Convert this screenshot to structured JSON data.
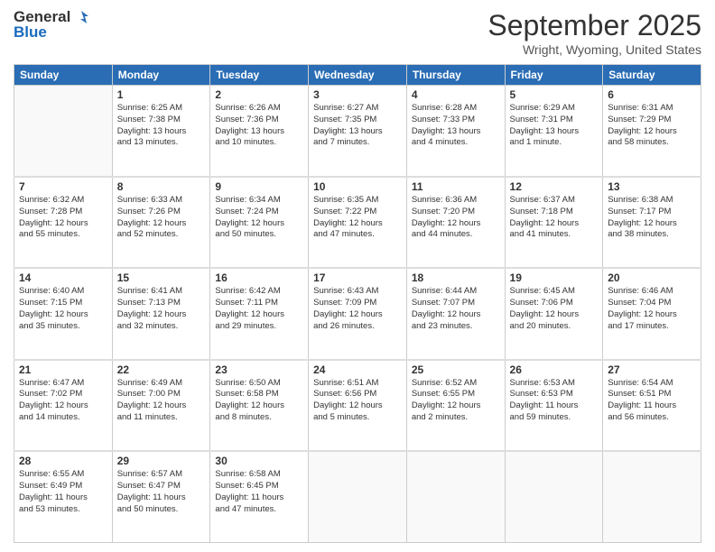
{
  "logo": {
    "general": "General",
    "blue": "Blue"
  },
  "header": {
    "month": "September 2025",
    "location": "Wright, Wyoming, United States"
  },
  "weekdays": [
    "Sunday",
    "Monday",
    "Tuesday",
    "Wednesday",
    "Thursday",
    "Friday",
    "Saturday"
  ],
  "weeks": [
    [
      {
        "day": "",
        "info": ""
      },
      {
        "day": "1",
        "info": "Sunrise: 6:25 AM\nSunset: 7:38 PM\nDaylight: 13 hours\nand 13 minutes."
      },
      {
        "day": "2",
        "info": "Sunrise: 6:26 AM\nSunset: 7:36 PM\nDaylight: 13 hours\nand 10 minutes."
      },
      {
        "day": "3",
        "info": "Sunrise: 6:27 AM\nSunset: 7:35 PM\nDaylight: 13 hours\nand 7 minutes."
      },
      {
        "day": "4",
        "info": "Sunrise: 6:28 AM\nSunset: 7:33 PM\nDaylight: 13 hours\nand 4 minutes."
      },
      {
        "day": "5",
        "info": "Sunrise: 6:29 AM\nSunset: 7:31 PM\nDaylight: 13 hours\nand 1 minute."
      },
      {
        "day": "6",
        "info": "Sunrise: 6:31 AM\nSunset: 7:29 PM\nDaylight: 12 hours\nand 58 minutes."
      }
    ],
    [
      {
        "day": "7",
        "info": "Sunrise: 6:32 AM\nSunset: 7:28 PM\nDaylight: 12 hours\nand 55 minutes."
      },
      {
        "day": "8",
        "info": "Sunrise: 6:33 AM\nSunset: 7:26 PM\nDaylight: 12 hours\nand 52 minutes."
      },
      {
        "day": "9",
        "info": "Sunrise: 6:34 AM\nSunset: 7:24 PM\nDaylight: 12 hours\nand 50 minutes."
      },
      {
        "day": "10",
        "info": "Sunrise: 6:35 AM\nSunset: 7:22 PM\nDaylight: 12 hours\nand 47 minutes."
      },
      {
        "day": "11",
        "info": "Sunrise: 6:36 AM\nSunset: 7:20 PM\nDaylight: 12 hours\nand 44 minutes."
      },
      {
        "day": "12",
        "info": "Sunrise: 6:37 AM\nSunset: 7:18 PM\nDaylight: 12 hours\nand 41 minutes."
      },
      {
        "day": "13",
        "info": "Sunrise: 6:38 AM\nSunset: 7:17 PM\nDaylight: 12 hours\nand 38 minutes."
      }
    ],
    [
      {
        "day": "14",
        "info": "Sunrise: 6:40 AM\nSunset: 7:15 PM\nDaylight: 12 hours\nand 35 minutes."
      },
      {
        "day": "15",
        "info": "Sunrise: 6:41 AM\nSunset: 7:13 PM\nDaylight: 12 hours\nand 32 minutes."
      },
      {
        "day": "16",
        "info": "Sunrise: 6:42 AM\nSunset: 7:11 PM\nDaylight: 12 hours\nand 29 minutes."
      },
      {
        "day": "17",
        "info": "Sunrise: 6:43 AM\nSunset: 7:09 PM\nDaylight: 12 hours\nand 26 minutes."
      },
      {
        "day": "18",
        "info": "Sunrise: 6:44 AM\nSunset: 7:07 PM\nDaylight: 12 hours\nand 23 minutes."
      },
      {
        "day": "19",
        "info": "Sunrise: 6:45 AM\nSunset: 7:06 PM\nDaylight: 12 hours\nand 20 minutes."
      },
      {
        "day": "20",
        "info": "Sunrise: 6:46 AM\nSunset: 7:04 PM\nDaylight: 12 hours\nand 17 minutes."
      }
    ],
    [
      {
        "day": "21",
        "info": "Sunrise: 6:47 AM\nSunset: 7:02 PM\nDaylight: 12 hours\nand 14 minutes."
      },
      {
        "day": "22",
        "info": "Sunrise: 6:49 AM\nSunset: 7:00 PM\nDaylight: 12 hours\nand 11 minutes."
      },
      {
        "day": "23",
        "info": "Sunrise: 6:50 AM\nSunset: 6:58 PM\nDaylight: 12 hours\nand 8 minutes."
      },
      {
        "day": "24",
        "info": "Sunrise: 6:51 AM\nSunset: 6:56 PM\nDaylight: 12 hours\nand 5 minutes."
      },
      {
        "day": "25",
        "info": "Sunrise: 6:52 AM\nSunset: 6:55 PM\nDaylight: 12 hours\nand 2 minutes."
      },
      {
        "day": "26",
        "info": "Sunrise: 6:53 AM\nSunset: 6:53 PM\nDaylight: 11 hours\nand 59 minutes."
      },
      {
        "day": "27",
        "info": "Sunrise: 6:54 AM\nSunset: 6:51 PM\nDaylight: 11 hours\nand 56 minutes."
      }
    ],
    [
      {
        "day": "28",
        "info": "Sunrise: 6:55 AM\nSunset: 6:49 PM\nDaylight: 11 hours\nand 53 minutes."
      },
      {
        "day": "29",
        "info": "Sunrise: 6:57 AM\nSunset: 6:47 PM\nDaylight: 11 hours\nand 50 minutes."
      },
      {
        "day": "30",
        "info": "Sunrise: 6:58 AM\nSunset: 6:45 PM\nDaylight: 11 hours\nand 47 minutes."
      },
      {
        "day": "",
        "info": ""
      },
      {
        "day": "",
        "info": ""
      },
      {
        "day": "",
        "info": ""
      },
      {
        "day": "",
        "info": ""
      }
    ]
  ]
}
